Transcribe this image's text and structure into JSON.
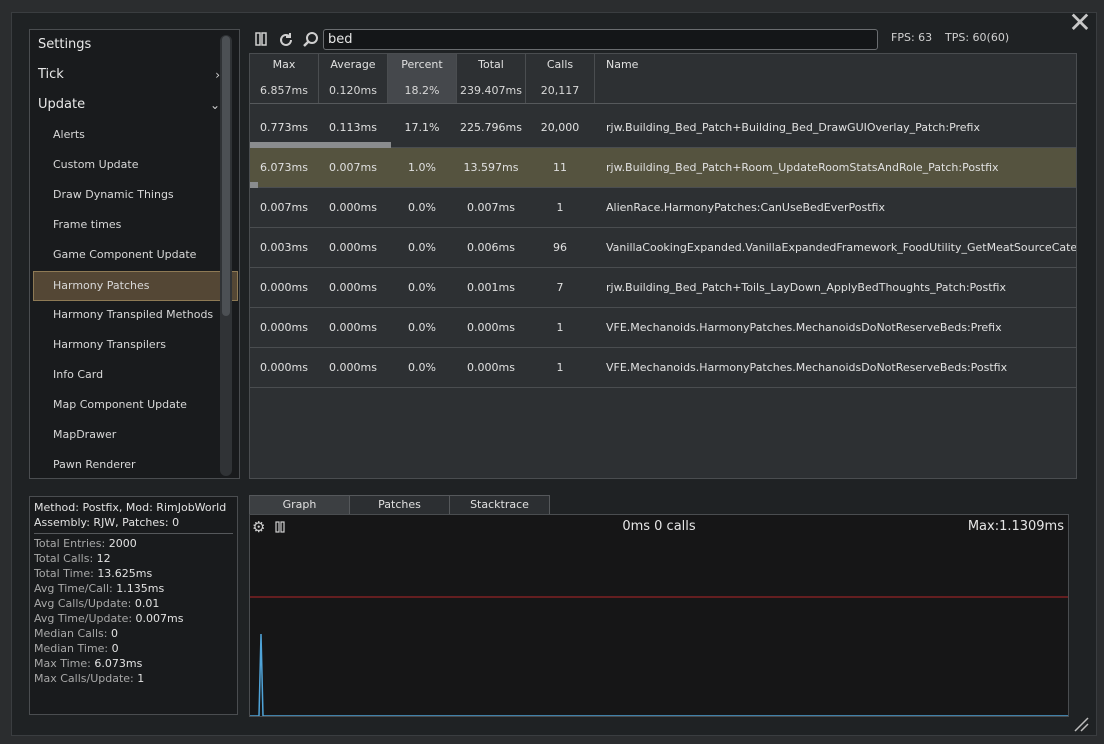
{
  "sidebar": {
    "items": [
      {
        "label": "Settings",
        "level": "top",
        "chevron": ""
      },
      {
        "label": "Tick",
        "level": "top",
        "chevron": "›"
      },
      {
        "label": "Update",
        "level": "top",
        "chevron": "⌄"
      },
      {
        "label": "Alerts",
        "level": "sub"
      },
      {
        "label": "Custom Update",
        "level": "sub"
      },
      {
        "label": "Draw Dynamic Things",
        "level": "sub"
      },
      {
        "label": "Frame times",
        "level": "sub"
      },
      {
        "label": "Game Component Update",
        "level": "sub"
      },
      {
        "label": "Harmony Patches",
        "level": "sub",
        "selected": true
      },
      {
        "label": "Harmony Transpiled Methods",
        "level": "sub"
      },
      {
        "label": "Harmony Transpilers",
        "level": "sub"
      },
      {
        "label": "Info Card",
        "level": "sub"
      },
      {
        "label": "Map Component Update",
        "level": "sub"
      },
      {
        "label": "MapDrawer",
        "level": "sub"
      },
      {
        "label": "Pawn Renderer",
        "level": "sub"
      }
    ]
  },
  "toolbar": {
    "pause_icon": "pause-icon",
    "refresh_icon": "refresh-icon",
    "search_icon": "search-icon",
    "search_value": "bed",
    "fps": "FPS: 63",
    "tps": "TPS: 60(60)"
  },
  "table": {
    "headers": [
      {
        "label": "Max",
        "total": "6.857ms"
      },
      {
        "label": "Average",
        "total": "0.120ms"
      },
      {
        "label": "Percent",
        "total": "18.2%"
      },
      {
        "label": "Total",
        "total": "239.407ms"
      },
      {
        "label": "Calls",
        "total": "20,117"
      },
      {
        "label": "Name",
        "total": ""
      }
    ],
    "rows": [
      {
        "max": "0.773ms",
        "avg": "0.113ms",
        "percent": "17.1%",
        "total": "225.796ms",
        "calls": "20,000",
        "name": "rjw.Building_Bed_Patch+Building_Bed_DrawGUIOverlay_Patch:Prefix",
        "fraction": 0.171
      },
      {
        "max": "6.073ms",
        "avg": "0.007ms",
        "percent": "1.0%",
        "total": "13.597ms",
        "calls": "11",
        "name": "rjw.Building_Bed_Patch+Room_UpdateRoomStatsAndRole_Patch:Postfix",
        "fraction": 0.01,
        "selected": true
      },
      {
        "max": "0.007ms",
        "avg": "0.000ms",
        "percent": "0.0%",
        "total": "0.007ms",
        "calls": "1",
        "name": "AlienRace.HarmonyPatches:CanUseBedEverPostfix",
        "fraction": 0
      },
      {
        "max": "0.003ms",
        "avg": "0.000ms",
        "percent": "0.0%",
        "total": "0.006ms",
        "calls": "96",
        "name": "VanillaCookingExpanded.VanillaExpandedFramework_FoodUtility_GetMeatSourceCate",
        "fraction": 0
      },
      {
        "max": "0.000ms",
        "avg": "0.000ms",
        "percent": "0.0%",
        "total": "0.001ms",
        "calls": "7",
        "name": "rjw.Building_Bed_Patch+Toils_LayDown_ApplyBedThoughts_Patch:Postfix",
        "fraction": 0
      },
      {
        "max": "0.000ms",
        "avg": "0.000ms",
        "percent": "0.0%",
        "total": "0.000ms",
        "calls": "1",
        "name": "VFE.Mechanoids.HarmonyPatches.MechanoidsDoNotReserveBeds:Prefix",
        "fraction": 0
      },
      {
        "max": "0.000ms",
        "avg": "0.000ms",
        "percent": "0.0%",
        "total": "0.000ms",
        "calls": "1",
        "name": "VFE.Mechanoids.HarmonyPatches.MechanoidsDoNotReserveBeds:Postfix",
        "fraction": 0
      }
    ]
  },
  "info": {
    "line1": "Method: Postfix, Mod: RimJobWorld",
    "line2": "Assembly: RJW, Patches: 0",
    "stats": [
      {
        "k": "Total Entries:",
        "v": "2000"
      },
      {
        "k": "Total Calls:",
        "v": "12"
      },
      {
        "k": "Total Time:",
        "v": "13.625ms"
      },
      {
        "k": "Avg Time/Call:",
        "v": "1.135ms"
      },
      {
        "k": "Avg Calls/Update:",
        "v": "0.01"
      },
      {
        "k": "Avg Time/Update:",
        "v": "0.007ms"
      },
      {
        "k": "Median Calls:",
        "v": "0"
      },
      {
        "k": "Median Time:",
        "v": "0"
      },
      {
        "k": "Max Time:",
        "v": "6.073ms"
      },
      {
        "k": "Max Calls/Update:",
        "v": "1"
      }
    ]
  },
  "tabs": [
    {
      "label": "Graph",
      "active": true
    },
    {
      "label": "Patches"
    },
    {
      "label": "Stacktrace"
    }
  ],
  "graph": {
    "title": "0ms 0 calls",
    "max_label": "Max:1.1309ms",
    "settings_icon": "gear-icon",
    "pause_icon": "pause-icon",
    "line_color": "#4fa3d8",
    "threshold_color": "#b3262a",
    "threshold_level": 0.59,
    "spike_level": 0.41
  }
}
